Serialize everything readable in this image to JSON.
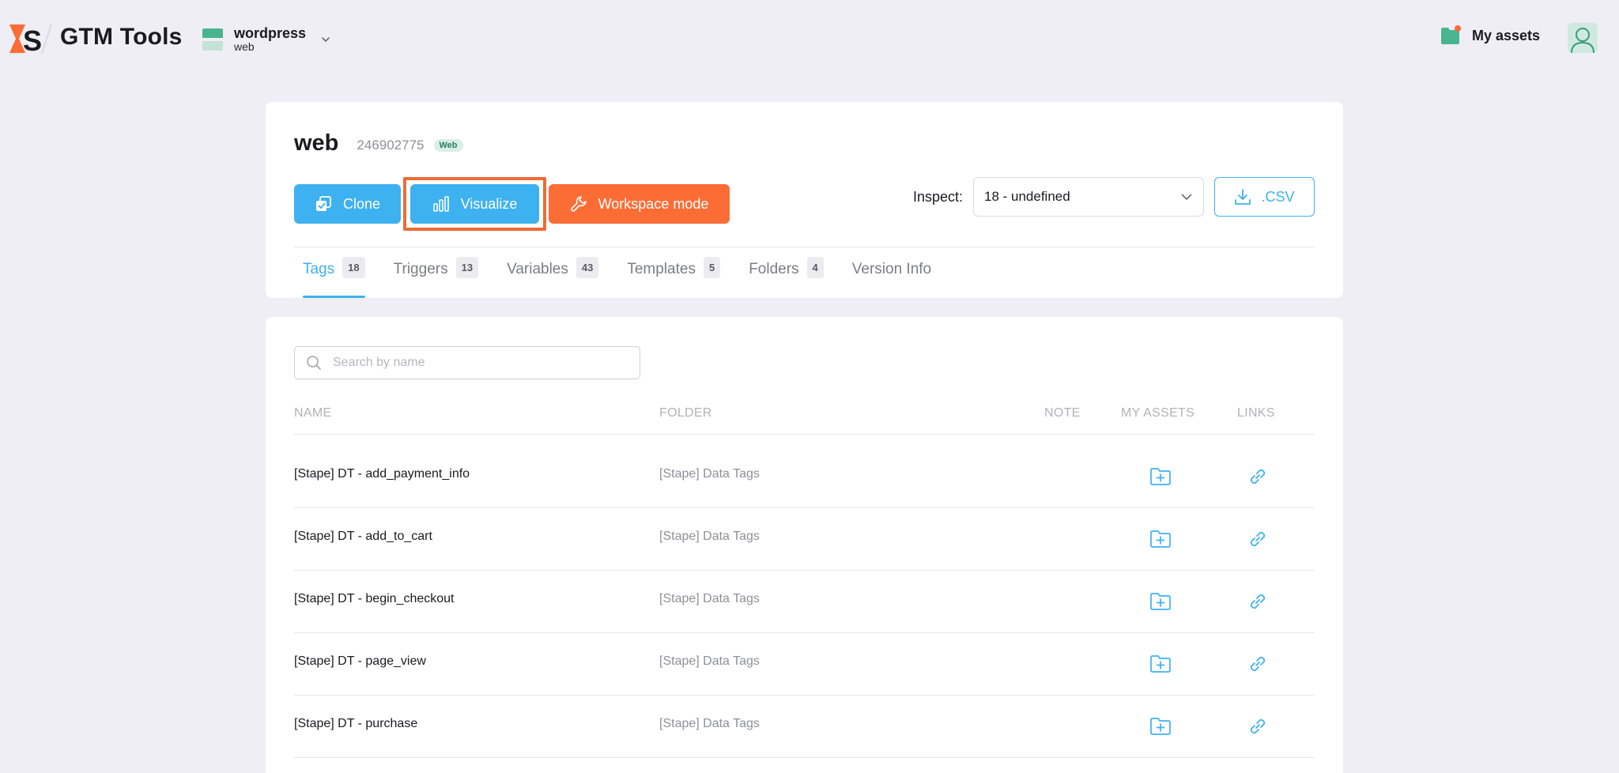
{
  "header": {
    "brand": "GTM Tools",
    "container_name": "wordpress",
    "container_sub": "web",
    "my_assets_label": "My assets"
  },
  "container": {
    "title": "web",
    "id": "246902775",
    "env_badge": "Web"
  },
  "actions": {
    "clone_label": "Clone",
    "visualize_label": "Visualize",
    "workspace_label": "Workspace mode",
    "inspect_label": "Inspect:",
    "inspect_value": "18 - undefined",
    "csv_label": ".CSV"
  },
  "tabs": [
    {
      "label": "Tags",
      "count": "18"
    },
    {
      "label": "Triggers",
      "count": "13"
    },
    {
      "label": "Variables",
      "count": "43"
    },
    {
      "label": "Templates",
      "count": "5"
    },
    {
      "label": "Folders",
      "count": "4"
    },
    {
      "label": "Version Info",
      "count": ""
    }
  ],
  "search": {
    "placeholder": "Search by name"
  },
  "table": {
    "headers": {
      "name": "NAME",
      "folder": "FOLDER",
      "note": "NOTE",
      "my_assets": "MY ASSETS",
      "links": "LINKS"
    },
    "rows": [
      {
        "name": "[Stape] DT - add_payment_info",
        "folder": "[Stape] Data Tags"
      },
      {
        "name": "[Stape] DT - add_to_cart",
        "folder": "[Stape] Data Tags"
      },
      {
        "name": "[Stape] DT - begin_checkout",
        "folder": "[Stape] Data Tags"
      },
      {
        "name": "[Stape] DT - page_view",
        "folder": "[Stape] Data Tags"
      },
      {
        "name": "[Stape] DT - purchase",
        "folder": "[Stape] Data Tags"
      }
    ]
  },
  "colors": {
    "accent_blue": "#3eb1f0",
    "accent_orange": "#fb6d35",
    "highlight_frame": "#f06a33",
    "background": "#efeef5"
  },
  "icons": [
    "stape-logo",
    "chevron-down-icon",
    "folder-icon",
    "avatar-icon",
    "clone-icon",
    "chart-icon",
    "wrench-icon",
    "download-icon",
    "search-icon",
    "folder-plus-icon",
    "link-icon"
  ]
}
